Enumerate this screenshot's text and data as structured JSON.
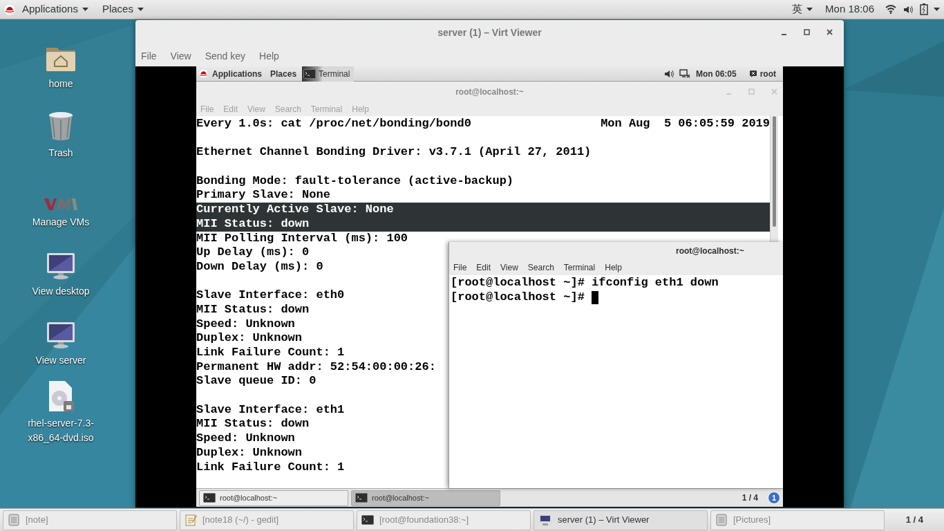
{
  "top_bar": {
    "menus": [
      "Applications",
      "Places"
    ],
    "input_method": "英",
    "clock": "Mon 18:06"
  },
  "desktop_icons": [
    {
      "label": "home",
      "kind": "folder"
    },
    {
      "label": "Trash",
      "kind": "trash"
    },
    {
      "label": "Manage VMs",
      "kind": "vm"
    },
    {
      "label": "View desktop",
      "kind": "monitor"
    },
    {
      "label": "View server",
      "kind": "monitor"
    },
    {
      "label": "rhel-server-7.3-x86_64-dvd.iso",
      "kind": "disc"
    }
  ],
  "viewer": {
    "title": "server (1) – Virt Viewer",
    "menu": [
      "File",
      "View",
      "Send key",
      "Help"
    ],
    "guest": {
      "top_bar": {
        "menus": [
          "Applications",
          "Places"
        ],
        "task": "Terminal",
        "clock": "Mon 06:05",
        "user": "root"
      },
      "terminal_main": {
        "title": "root@localhost:~",
        "menu": [
          "File",
          "Edit",
          "View",
          "Search",
          "Terminal",
          "Help"
        ],
        "header_left": "Every 1.0s: cat /proc/net/bonding/bond0",
        "header_right": "Mon Aug  5 06:05:59 2019",
        "lines": [
          {
            "selected": false
          },
          {
            "text": "Ethernet Channel Bonding Driver: v3.7.1 (April 27, 2011)",
            "selected": false
          },
          {
            "selected": false
          },
          {
            "text": "Bonding Mode: fault-tolerance (active-backup)",
            "selected": false
          },
          {
            "text": "Primary Slave: None",
            "selected": false
          },
          {
            "text": "Currently Active Slave: None",
            "selected": true
          },
          {
            "text": "MII Status: down",
            "selected": true
          },
          {
            "text": "MII Polling Interval (ms): 100",
            "selected": false
          },
          {
            "text": "Up Delay (ms): 0",
            "selected": false
          },
          {
            "text": "Down Delay (ms): 0",
            "selected": false
          },
          {
            "selected": false
          },
          {
            "text": "Slave Interface: eth0",
            "selected": false
          },
          {
            "text": "MII Status: down",
            "selected": false
          },
          {
            "text": "Speed: Unknown",
            "selected": false
          },
          {
            "text": "Duplex: Unknown",
            "selected": false
          },
          {
            "text": "Link Failure Count: 1",
            "selected": false
          },
          {
            "text": "Permanent HW addr: 52:54:00:00:26:",
            "selected": false
          },
          {
            "text": "Slave queue ID: 0",
            "selected": false
          },
          {
            "selected": false
          },
          {
            "text": "Slave Interface: eth1",
            "selected": false
          },
          {
            "text": "MII Status: down",
            "selected": false
          },
          {
            "text": "Speed: Unknown",
            "selected": false
          },
          {
            "text": "Duplex: Unknown",
            "selected": false
          },
          {
            "text": "Link Failure Count: 1",
            "selected": false
          }
        ]
      },
      "terminal_small": {
        "title": "root@localhost:~",
        "menu": [
          "File",
          "Edit",
          "View",
          "Search",
          "Terminal",
          "Help"
        ],
        "lines": [
          "[root@localhost ~]# ifconfig eth1 down",
          "[root@localhost ~]#"
        ],
        "cursor": true
      },
      "taskbar": {
        "items": [
          {
            "label": "root@localhost:~",
            "selected": false
          },
          {
            "label": "root@localhost:~",
            "selected": true
          }
        ],
        "workspace": "1 / 4",
        "notification_count": "1"
      }
    }
  },
  "taskbar": {
    "items": [
      {
        "label": "[note]",
        "kind": "note",
        "selected": false
      },
      {
        "label": "[note18 (~/) - gedit]",
        "kind": "gedit",
        "selected": false
      },
      {
        "label": "[root@foundation38:~]",
        "kind": "terminal",
        "selected": false
      },
      {
        "label": "server (1) – Virt Viewer",
        "kind": "monitor",
        "selected": true
      },
      {
        "label": "[Pictures]",
        "kind": "note",
        "selected": false
      }
    ],
    "workspace": "1 / 4"
  }
}
